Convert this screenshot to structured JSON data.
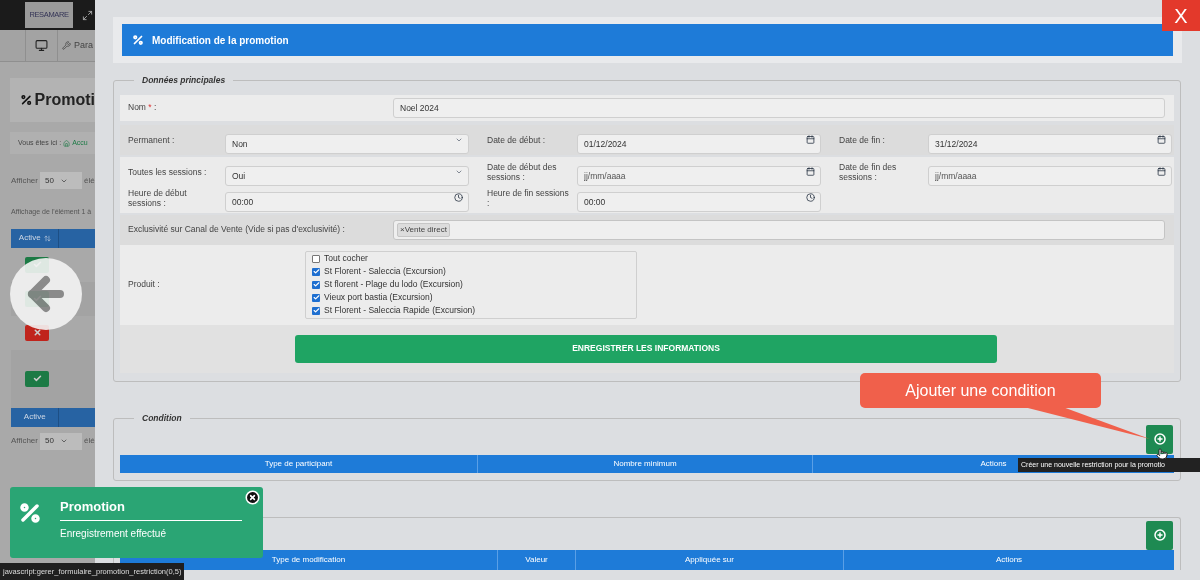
{
  "background_page": {
    "logo": "RESAMARE",
    "toolbar_item": "Para",
    "title": "Promoti",
    "breadcrumb": {
      "label": "Vous êtes ici :",
      "link": "Accu"
    },
    "length_top": {
      "label": "Afficher",
      "value": "50",
      "suffix": "élé"
    },
    "info": "Affichage de l'élément 1 à",
    "table": {
      "header": "Active",
      "rows": [
        {
          "active": true
        },
        {
          "active": true
        },
        {
          "active": false
        },
        {
          "active": true
        }
      ],
      "footer": "Active"
    },
    "length_bottom": {
      "label": "Afficher",
      "value": "50",
      "suffix": "élé"
    }
  },
  "close_button": "X",
  "modal": {
    "title": "Modification de la promotion",
    "main": {
      "legend": "Données principales",
      "name": {
        "label": "Nom",
        "required_mark": "*",
        "label_end": ":",
        "value": "Noel 2024"
      },
      "fields": [
        {
          "label": "Permanent :",
          "kind": "select",
          "value": "Non"
        },
        {
          "label": "Date de début :",
          "kind": "date",
          "value": "01/12/2024"
        },
        {
          "label": "Date de fin :",
          "kind": "date",
          "value": "31/12/2024"
        },
        {
          "label": "Toutes les sessions :",
          "kind": "select",
          "value": "Oui"
        },
        {
          "label": "Date de début des sessions :",
          "kind": "date",
          "placeholder": "jj/mm/aaaa"
        },
        {
          "label": "Date de fin des sessions :",
          "kind": "date",
          "placeholder": "jj/mm/aaaa"
        },
        {
          "label": "Heure de début sessions :",
          "kind": "time",
          "value": "00:00"
        },
        {
          "label": "Heure de fin sessions :",
          "kind": "time",
          "value": "00:00"
        }
      ],
      "exclusivity": {
        "label": "Exclusivité sur Canal de Vente (Vide si pas d'exclusivité) :",
        "tags": [
          {
            "remove": "×",
            "label": "Vente direct"
          }
        ]
      },
      "product": {
        "label": "Produit :",
        "options": [
          {
            "label": "Tout cocher",
            "checked": false
          },
          {
            "label": "St Florent - Saleccia (Excursion)",
            "checked": true
          },
          {
            "label": "St florent - Plage du lodo (Excursion)",
            "checked": true
          },
          {
            "label": "Vieux port bastia (Excursion)",
            "checked": true
          },
          {
            "label": "St Florent - Saleccia Rapide (Excursion)",
            "checked": true
          }
        ]
      },
      "save_button": "ENREGISTRER LES INFORMATIONS"
    },
    "condition": {
      "legend": "Condition",
      "columns": [
        "Type de participant",
        "Nombre minimum",
        "Actions"
      ],
      "tooltip": "Créer une nouvelle restriction pour la promotio"
    },
    "modification": {
      "columns": [
        "Type de modification",
        "Valeur",
        "Appliquée sur",
        "Actions"
      ]
    }
  },
  "callout": "Ajouter une condition",
  "toast": {
    "title": "Promotion",
    "message": "Enregistrement effectué"
  },
  "status_bar": "javascript:gerer_formulaire_promotion_restriction(0,5)"
}
